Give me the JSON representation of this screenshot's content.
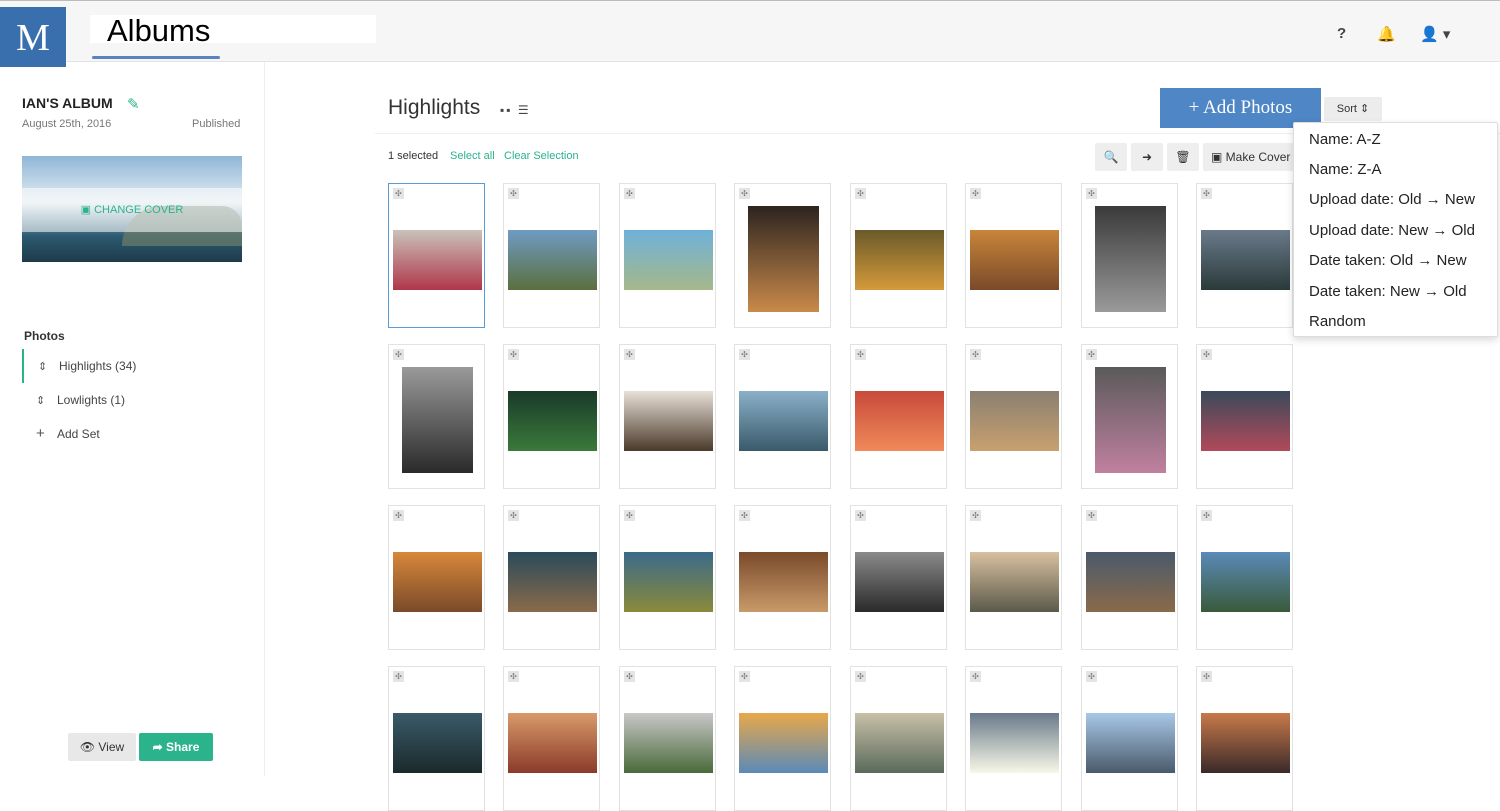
{
  "topbar": {
    "logo": "M",
    "title": "Albums",
    "help": "?",
    "bell": "🔔",
    "user": "👤 ▾"
  },
  "sidebar": {
    "album_name": "IAN'S ALBUM",
    "pencil": "✎",
    "date": "August 25th, 2016",
    "status": "Published",
    "change_cover": "▣ CHANGE COVER",
    "photos_heading": "Photos",
    "sets": [
      {
        "icon": "⇕",
        "label": "Highlights (34)"
      },
      {
        "icon": "⇕",
        "label": "Lowlights (1)"
      },
      {
        "icon": "+",
        "label": "Add Set"
      }
    ],
    "view_label": "👁 View",
    "share_label": "➦ Share"
  },
  "main": {
    "title": "Highlights",
    "view_icons": "▪▪ ☰",
    "add_photos": "+ Add Photos",
    "sort": "Sort ⇕",
    "selected_count": "1 selected",
    "select_all": "Select all",
    "clear_selection": "Clear Selection",
    "zoom_icon": "🔍",
    "move_icon": "➜",
    "trash_icon": "🗑",
    "make_cover": "▣ Make Cover",
    "drag_glyph": "✣"
  },
  "sort_menu": [
    "Name: A-Z",
    "Name: Z-A",
    "Upload date: Old → New",
    "Upload date: New → Old",
    "Date taken: Old → New",
    "Date taken: New → Old",
    "Random"
  ],
  "photo_colors": [
    [
      "#c9c2ba",
      "#b0364a"
    ],
    [
      "#6f9bc4",
      "#5b6f3e"
    ],
    [
      "#6fb1d8",
      "#a5b88a"
    ],
    [
      "#2c2420",
      "#c98a4a"
    ],
    [
      "#6a5a2a",
      "#d59a3a"
    ],
    [
      "#c9853a",
      "#7a4a2a"
    ],
    [
      "#3a3a3a",
      "#9a9a9a"
    ],
    [
      "#6a7a8a",
      "#2a3a3a"
    ],
    [
      "#9a9a9a",
      "#2a2a2a"
    ],
    [
      "#1a3a2a",
      "#3a7a3a"
    ],
    [
      "#e8e0d8",
      "#4a3a2a"
    ],
    [
      "#8ab0c8",
      "#3a5a6a"
    ],
    [
      "#c84a3a",
      "#f08a5a"
    ],
    [
      "#8a8070",
      "#c8a070"
    ],
    [
      "#5a5a5a",
      "#c080a0"
    ],
    [
      "#3a4a5a",
      "#b04a5a"
    ],
    [
      "#d8883a",
      "#7a4a2a"
    ],
    [
      "#2a4a5a",
      "#8a6a4a"
    ],
    [
      "#3a6a8a",
      "#8a8a3a"
    ],
    [
      "#7a4a2a",
      "#c89a6a"
    ],
    [
      "#8a8a8a",
      "#2a2a2a"
    ],
    [
      "#d8c0a0",
      "#5a5a4a"
    ],
    [
      "#4a5a6a",
      "#8a6a4a"
    ],
    [
      "#5a8ab8",
      "#3a5a3a"
    ],
    [
      "#3a5a6a",
      "#1a2a2a"
    ],
    [
      "#d89a6a",
      "#8a3a2a"
    ],
    [
      "#c8c8c8",
      "#4a6a3a"
    ],
    [
      "#e8a84a",
      "#5a8ab8"
    ],
    [
      "#c8c0a8",
      "#5a6a5a"
    ],
    [
      "#6a7a8a",
      "#f8f8e8"
    ],
    [
      "#a8c8e8",
      "#4a5a6a"
    ],
    [
      "#c87a4a",
      "#3a2a2a"
    ]
  ]
}
